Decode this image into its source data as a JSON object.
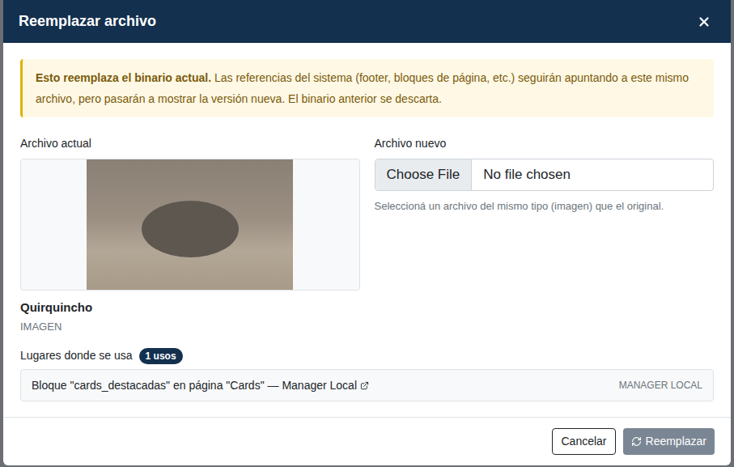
{
  "dialog": {
    "title": "Reemplazar archivo"
  },
  "warning": {
    "bold": "Esto reemplaza el binario actual.",
    "text": "Las referencias del sistema (footer, bloques de página, etc.) seguirán apuntando a este mismo archivo, pero pasarán a mostrar la versión nueva. El binario anterior se descarta."
  },
  "current": {
    "label": "Archivo actual",
    "name": "Quirquincho",
    "type": "IMAGEN"
  },
  "new_file": {
    "label": "Archivo nuevo",
    "button": "Choose File",
    "status": "No file chosen",
    "help": "Seleccioná un archivo del mismo tipo (imagen) que el original."
  },
  "usages": {
    "label": "Lugares donde se usa",
    "count": "1 usos",
    "items": [
      {
        "text": "Bloque \"cards_destacadas\" en página \"Cards\" — Manager Local",
        "source": "MANAGER LOCAL"
      }
    ]
  },
  "buttons": [
    {
      "label": "Cancelar",
      "kind": "secondary",
      "disabled": false
    },
    {
      "label": "Reemplazar",
      "kind": "primary",
      "disabled": true
    }
  ]
}
